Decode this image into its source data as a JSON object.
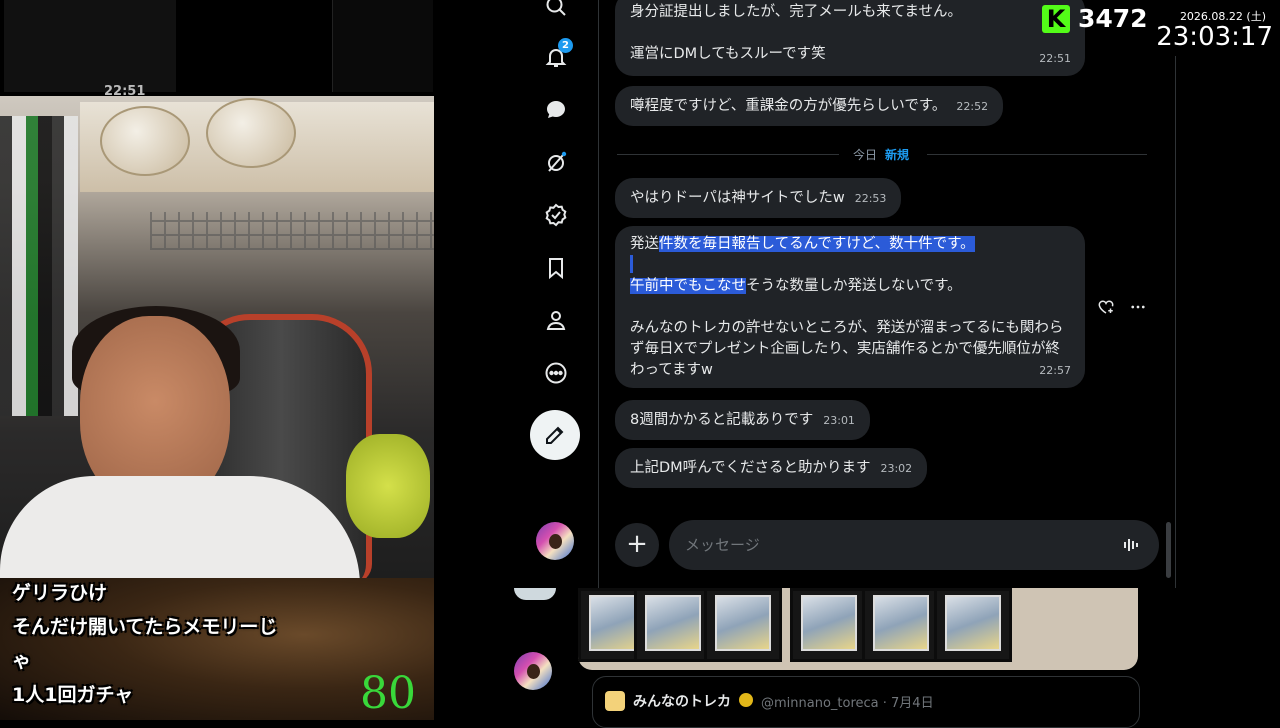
{
  "stream": {
    "thumbnail_time": "22:51",
    "comments": [
      "ゲリラひけ",
      "そんだけ開いてたらメモリーじ",
      "ゃ",
      "1人1回ガチャ"
    ],
    "counter": "80",
    "viewer_count": "3472",
    "kick_logo": "K",
    "date": "2026.08.22 (土)",
    "time": "23:03:17"
  },
  "nav": {
    "notification_badge": "2",
    "icons": [
      "search-icon",
      "bell-icon",
      "chat-icon",
      "grok-icon",
      "verified-check-icon",
      "bookmark-icon",
      "profile-icon",
      "more-icon",
      "compose-icon"
    ]
  },
  "dm": {
    "messages": [
      {
        "lines": [
          "身分証提出しましたが、完了メールも来てません。",
          "",
          "運営にDMしてもスルーです笑"
        ],
        "time": "22:51"
      },
      {
        "text": "噂程度ですけど、重課金の方が優先らしいです。",
        "time": "22:52"
      },
      {
        "text": "やはりドーパは神サイトでしたw",
        "time": "22:53"
      },
      {
        "p1_plain": "発送",
        "p1_hl": "件数を毎日報告してるんですけど、数十件です。",
        "p2_hl": "午前中でもこなせ",
        "p2_plain": "そうな数量しか発送しないです。",
        "p3": "みんなのトレカの許せないところが、発送が溜まってるにも関わらず毎日Xでプレゼント企画したり、実店舗作るとかで優先順位が終わってますw",
        "time": "22:57"
      },
      {
        "text": "8週間かかると記載ありです",
        "time": "23:01"
      },
      {
        "text": "上記DM呼んでくださると助かります",
        "time": "23:02"
      }
    ],
    "divider": {
      "label": "今日",
      "new_label": "新規"
    },
    "composer": {
      "placeholder": "メッセージ"
    }
  },
  "timeline": {
    "quote_name": "みんなのトレカ",
    "quote_handle": "@minnano_toreca · 7月4日"
  },
  "colors": {
    "accent": "#1d9bf0",
    "bubble": "#202327",
    "highlight": "#2b5bd8",
    "kick_green": "#53fc18",
    "counter_green": "#39d83a"
  }
}
